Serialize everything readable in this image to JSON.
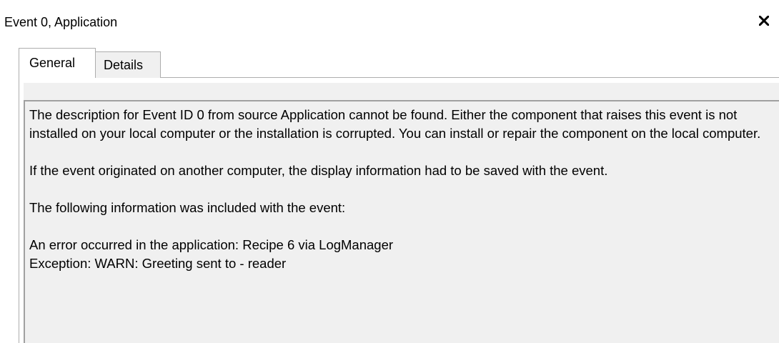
{
  "window": {
    "title": "Event 0, Application"
  },
  "tabs": [
    {
      "label": "General",
      "selected": true
    },
    {
      "label": "Details",
      "selected": false
    }
  ],
  "description": {
    "para1": "The description for Event ID 0 from source Application cannot be found. Either the component that raises this event is not installed on your local computer or the installation is corrupted. You can install or repair the component on the local computer.",
    "para2": "If the event originated on another computer, the display information had to be saved with the event.",
    "para3": "The following information was included with the event:",
    "line4": "An error occurred in the application: Recipe 6 via LogManager",
    "line5": "Exception: WARN: Greeting sent to - reader"
  },
  "icons": {
    "close": "close-icon"
  }
}
